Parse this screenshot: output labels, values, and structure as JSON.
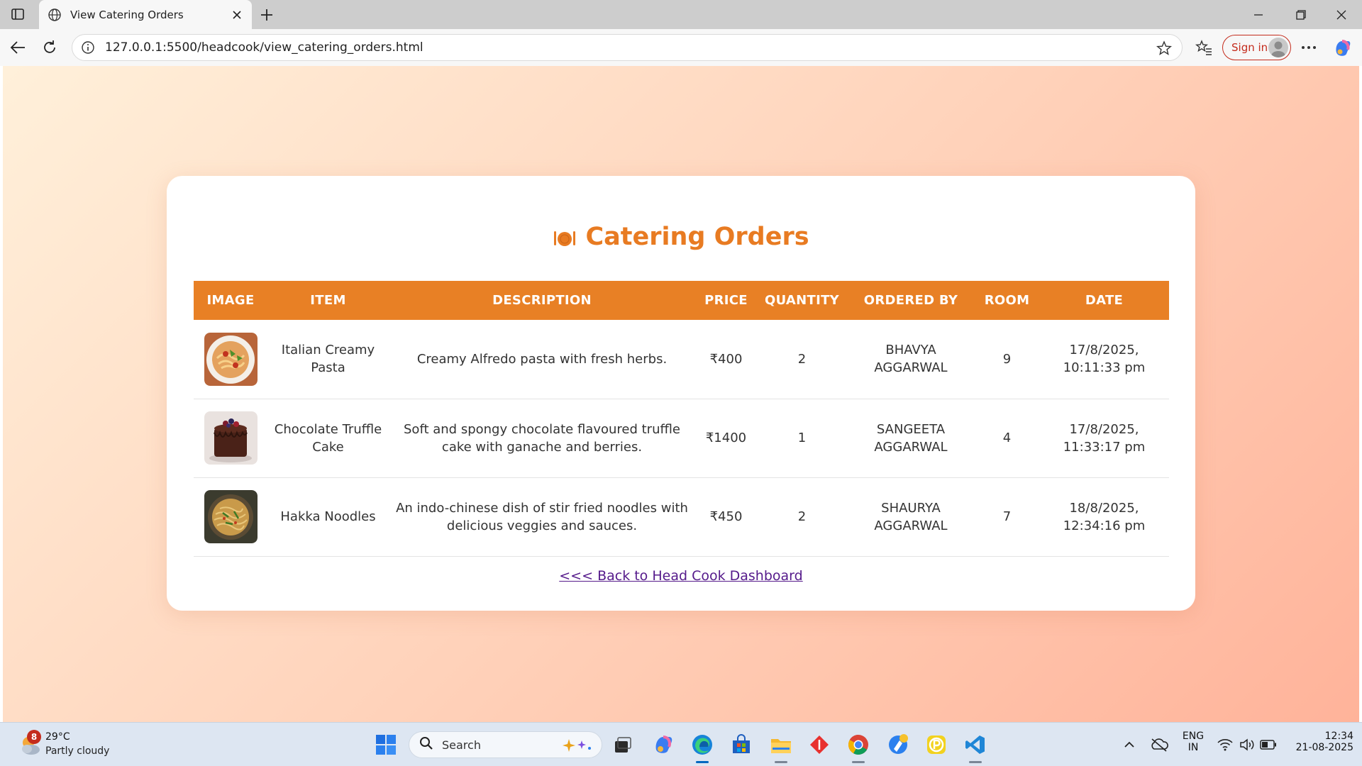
{
  "browser": {
    "tab_title": "View Catering Orders",
    "url": "127.0.0.1:5500/headcook/view_catering_orders.html",
    "signin_label": "Sign in"
  },
  "page": {
    "title": "Catering Orders",
    "title_icon": "plate-cutlery-icon",
    "accent_color": "#e88025",
    "columns": [
      "IMAGE",
      "ITEM",
      "DESCRIPTION",
      "PRICE",
      "QUANTITY",
      "ORDERED BY",
      "ROOM",
      "DATE"
    ],
    "orders": [
      {
        "image": "pasta-image",
        "item": "Italian Creamy Pasta",
        "description": "Creamy Alfredo pasta with fresh herbs.",
        "price": "₹400",
        "quantity": "2",
        "ordered_by": "BHAVYA AGGARWAL",
        "room": "9",
        "date": "17/8/2025, 10:11:33 pm"
      },
      {
        "image": "chocolate-cake-image",
        "item": "Chocolate Truffle Cake",
        "description": "Soft and spongy chocolate flavoured truffle cake with ganache and berries.",
        "price": "₹1400",
        "quantity": "1",
        "ordered_by": "SANGEETA AGGARWAL",
        "room": "4",
        "date": "17/8/2025, 11:33:17 pm"
      },
      {
        "image": "noodles-image",
        "item": "Hakka Noodles",
        "description": "An indo-chinese dish of stir fried noodles with delicious veggies and sauces.",
        "price": "₹450",
        "quantity": "2",
        "ordered_by": "SHAURYA AGGARWAL",
        "room": "7",
        "date": "18/8/2025, 12:34:16 pm"
      }
    ],
    "back_link": "<<< Back to Head Cook Dashboard"
  },
  "taskbar": {
    "weather_badge": "8",
    "temperature": "29°C",
    "condition": "Partly cloudy",
    "search_label": "Search",
    "language_line1": "ENG",
    "language_line2": "IN",
    "time": "12:34",
    "date": "21-08-2025"
  }
}
